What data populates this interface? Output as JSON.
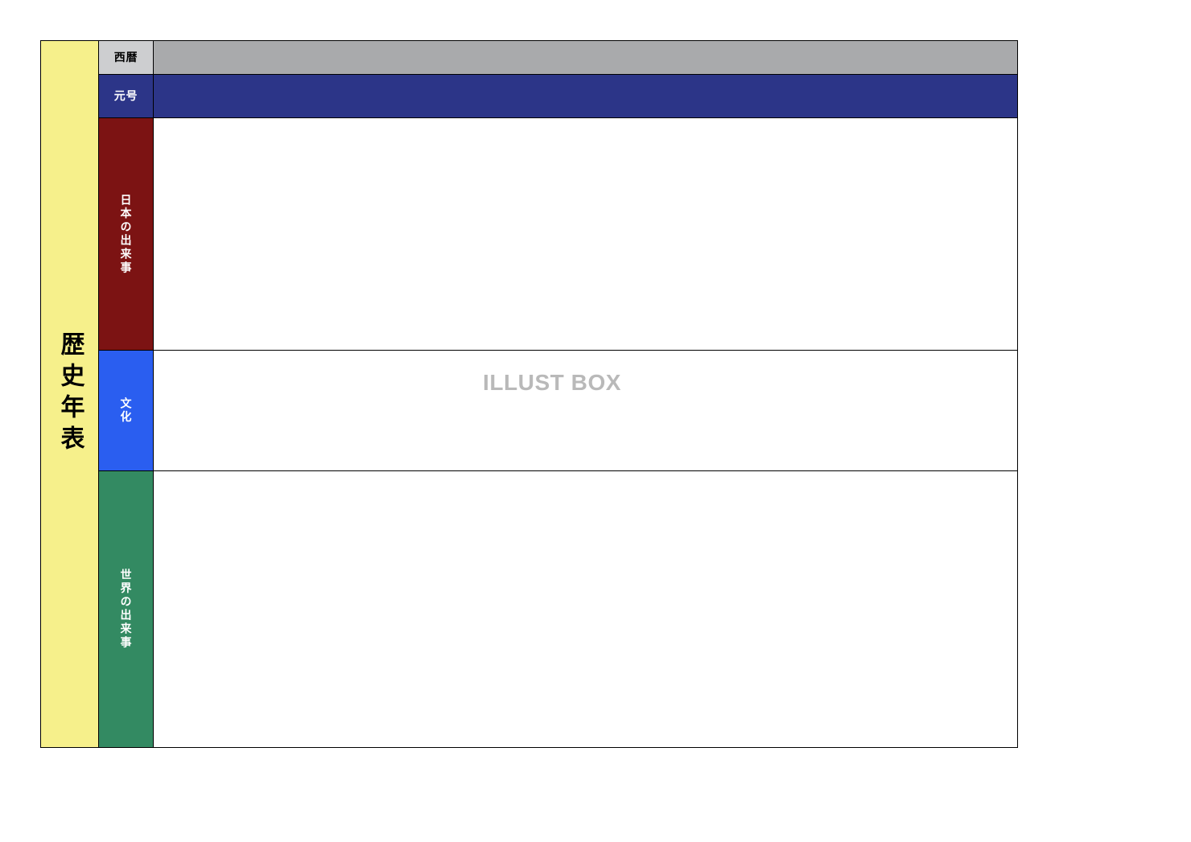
{
  "title": "歴史年表",
  "rows": {
    "seireki": {
      "label": "西暦"
    },
    "gengo": {
      "label": "元号"
    },
    "nihon": {
      "label": "日本の出来事"
    },
    "bunka": {
      "label": "文化"
    },
    "sekai": {
      "label": "世界の出来事"
    }
  },
  "watermark": "ILLUST BOX"
}
